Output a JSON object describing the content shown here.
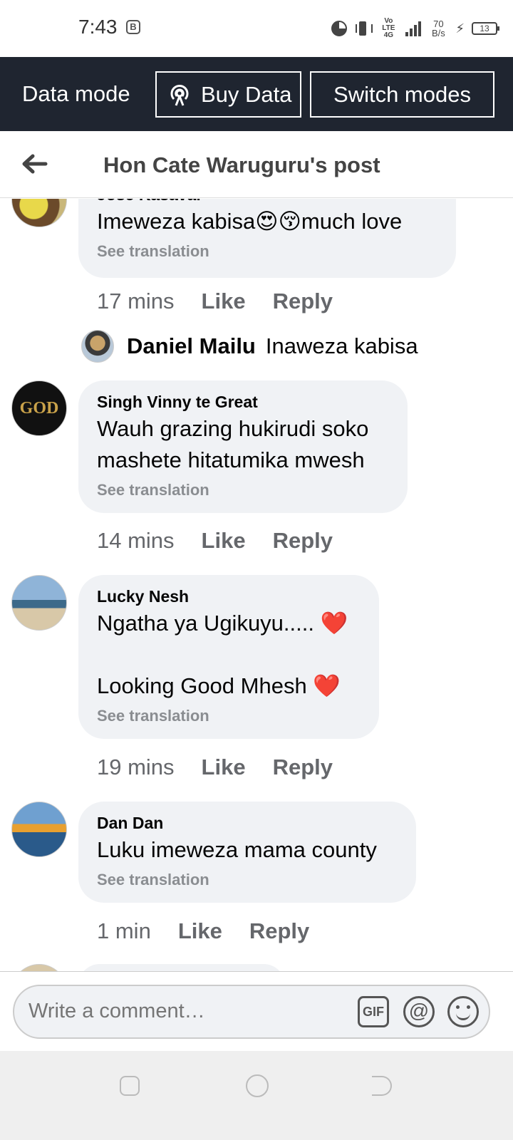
{
  "status_bar": {
    "time": "7:43",
    "network": "Vo LTE 4G",
    "speed": "70 B/s",
    "battery": "13"
  },
  "data_mode_bar": {
    "title": "Data mode",
    "buy_data_label": "Buy Data",
    "switch_modes_label": "Switch modes"
  },
  "header": {
    "title": "Hon Cate Waruguru's post"
  },
  "comments": [
    {
      "author": "Jose Kasaval",
      "text": "Imeweza kabisa😍😚much love",
      "see_translation": "See translation",
      "time": "17 mins",
      "like": "Like",
      "reply": "Reply",
      "reply_preview": {
        "author": "Daniel Mailu",
        "text": "Inaweza kabisa"
      }
    },
    {
      "author": "Singh Vinny te Great",
      "text": "Wauh grazing hukirudi soko\nmashete hitatumika mwesh",
      "see_translation": "See translation",
      "time": "14 mins",
      "like": "Like",
      "reply": "Reply"
    },
    {
      "author": "Lucky Nesh",
      "text": "Ngatha ya Ugikuyu..... ❤️\n\nLooking Good Mhesh ❤️",
      "see_translation": "See translation",
      "time": "19 mins",
      "like": "Like",
      "reply": "Reply"
    },
    {
      "author": "Dan Dan",
      "text": "Luku imeweza mama county",
      "see_translation": "See translation",
      "time": "1 min",
      "like": "Like",
      "reply": "Reply"
    }
  ],
  "composer": {
    "placeholder": "Write a comment…",
    "gif_label": "GIF"
  },
  "colors": {
    "data_bar_bg": "#1f2530",
    "bubble_bg": "#f0f2f5",
    "meta_text": "#65676b"
  }
}
